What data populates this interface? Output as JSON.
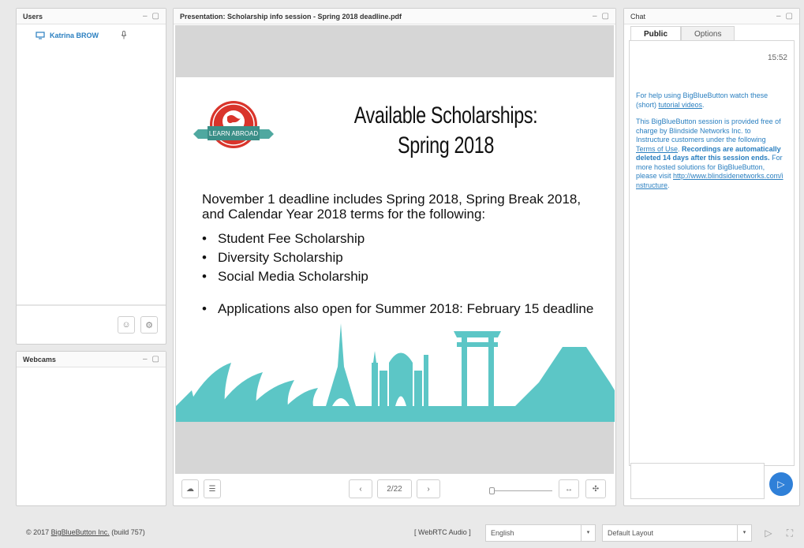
{
  "users": {
    "title": "Users",
    "minimize": "–",
    "maximize": "▢",
    "list": [
      {
        "name": "Katrina BROW"
      }
    ]
  },
  "webcams": {
    "title": "Webcams",
    "minimize": "–",
    "maximize": "▢"
  },
  "presentation": {
    "title": "Presentation: Scholarship info session - Spring 2018 deadline.pdf",
    "minimize": "–",
    "maximize": "▢",
    "slide": {
      "title_line1": "Available Scholarships:",
      "title_line2": "Spring 2018",
      "logo_text": "LEARN ABROAD",
      "intro": "November 1 deadline includes Spring 2018, Spring Break 2018, and Calendar Year 2018 terms for the following:",
      "bullets": [
        "Student Fee Scholarship",
        "Diversity Scholarship",
        "Social Media Scholarship"
      ],
      "extra_bullet": "Applications also open for Summer 2018: February 15 deadline"
    },
    "page_indicator": "2/22"
  },
  "chat": {
    "title": "Chat",
    "minimize": "–",
    "maximize": "▢",
    "tabs": [
      {
        "label": "Public"
      },
      {
        "label": "Options"
      }
    ],
    "time": "15:52",
    "message1_pre": "For help using BigBlueButton watch these (short) ",
    "message1_link": "tutorial videos",
    "message1_post": ".",
    "message2_pre": "This BigBlueButton session is provided free of charge by Blindside Networks Inc. to Instructure customers under the following ",
    "message2_link": "Terms of Use",
    "message2_mid": ".  ",
    "message2_bold": "Recordings are automatically deleted 14 days after this session ends.",
    "message2_post": "  For more hosted solutions for BigBlueButton, please visit ",
    "message2_url": "http://www.blindsidenetworks.com/instructure",
    "message2_end": "."
  },
  "footer": {
    "copyright_pre": "© 2017 ",
    "copyright_link": "BigBlueButton Inc.",
    "copyright_post": " (build 757)",
    "audio_label": "[ WebRTC Audio ]",
    "language": "English",
    "layout": "Default Layout"
  },
  "colors": {
    "accent": "#2a7fc0",
    "send_button": "#2f80d8",
    "skyline": "#5cc6c6",
    "logo_red": "#d9342b"
  }
}
